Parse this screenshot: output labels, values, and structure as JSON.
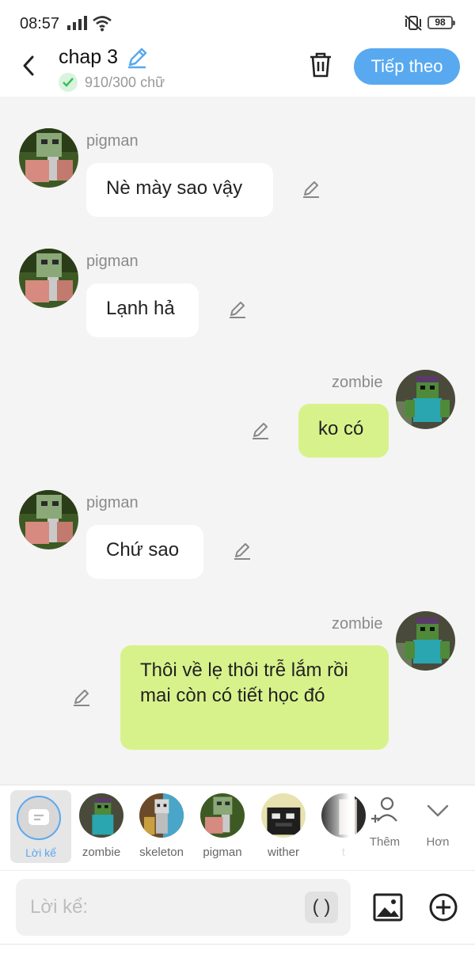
{
  "status_bar": {
    "time": "08:57",
    "battery": "98"
  },
  "header": {
    "title": "chap 3",
    "word_count": "910/300 chữ",
    "next_label": "Tiếp theo"
  },
  "messages": [
    {
      "side": "left",
      "name": "pigman",
      "text": "Nè mày sao vậy"
    },
    {
      "side": "left",
      "name": "pigman",
      "text": "Lạnh hả"
    },
    {
      "side": "right",
      "name": "zombie",
      "text": "ko có"
    },
    {
      "side": "left",
      "name": "pigman",
      "text": "Chứ sao"
    },
    {
      "side": "right",
      "name": "zombie",
      "text": "Thôi về lẹ thôi trễ lắm rồi mai còn có tiết học đó"
    }
  ],
  "character_bar": {
    "narrator_label": "Lời kể",
    "characters": [
      "zombie",
      "skeleton",
      "pigman",
      "wither",
      "t"
    ],
    "add_label": "Thêm",
    "more_label": "Hơn"
  },
  "input": {
    "placeholder": "Lời kể:",
    "paren_label": "( )"
  },
  "colors": {
    "accent": "#58a9f0",
    "right_bubble": "#d8f28b",
    "left_bubble": "#ffffff",
    "background": "#f4f4f4"
  }
}
